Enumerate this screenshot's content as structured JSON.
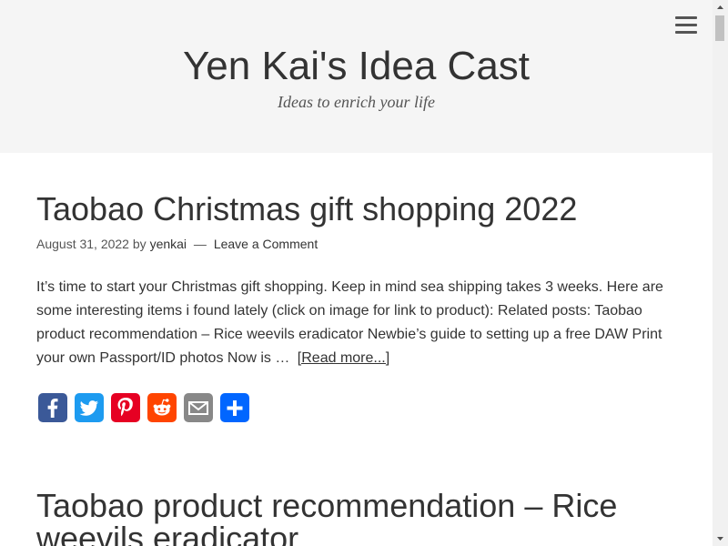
{
  "header": {
    "site_title": "Yen Kai's Idea Cast",
    "tagline": "Ideas to enrich your life",
    "menu_icon": "hamburger-menu-icon"
  },
  "posts": [
    {
      "title": "Taobao Christmas gift shopping 2022",
      "date": "August 31, 2022",
      "by": "by",
      "author": "yenkai",
      "separator": "—",
      "comment_link": "Leave a Comment",
      "excerpt": "It’s time to start your Christmas gift shopping. Keep in mind sea shipping takes 3 weeks. Here are some interesting items i found lately (click on image for link to product): Related posts: Taobao product recommendation – Rice weevils eradicator Newbie’s guide to setting up a free DAW Print your own Passport/ID photos Now is …",
      "read_more": "[Read more...]"
    },
    {
      "title": "Taobao product recommendation – Rice weevils eradicator"
    }
  ],
  "share": [
    {
      "name": "facebook",
      "icon": "facebook-icon",
      "color": "#3b5998"
    },
    {
      "name": "twitter",
      "icon": "twitter-icon",
      "color": "#1d9bf0"
    },
    {
      "name": "pinterest",
      "icon": "pinterest-icon",
      "color": "#e60023"
    },
    {
      "name": "reddit",
      "icon": "reddit-icon",
      "color": "#ff4500"
    },
    {
      "name": "email",
      "icon": "email-icon",
      "color": "#888888"
    },
    {
      "name": "share",
      "icon": "share-icon",
      "color": "#0166ff"
    }
  ]
}
